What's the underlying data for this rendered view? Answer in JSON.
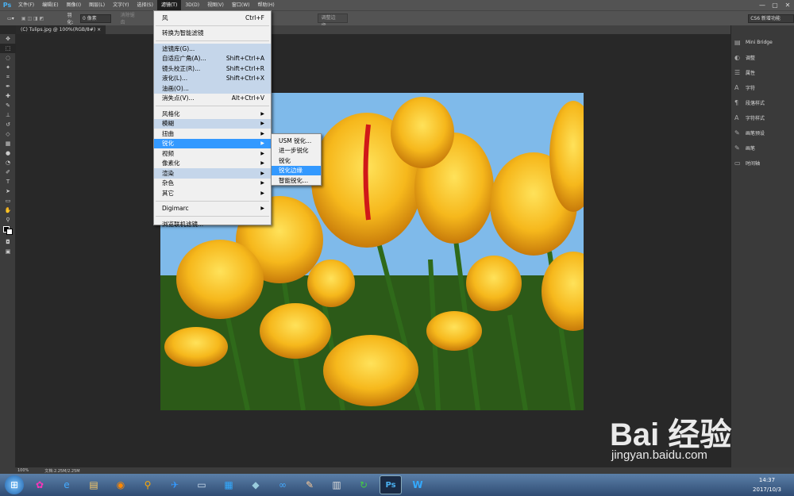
{
  "app": {
    "logo": "Ps"
  },
  "menubar": [
    "文件(F)",
    "编辑(E)",
    "图像(I)",
    "图层(L)",
    "文字(Y)",
    "选择(S)",
    "滤镜(T)",
    "3D(D)",
    "视图(V)",
    "窗口(W)",
    "帮助(H)"
  ],
  "window_controls": [
    "—",
    "▢",
    "✕"
  ],
  "options": {
    "feather_label": "羽化:",
    "feather_value": "0 像素",
    "anti_alias": "消除锯齿",
    "refine_edge": "调整边缘...",
    "workspace": "CS6 新增功能"
  },
  "document_tab": "(C) Tulips.jpg @ 100%(RGB/8#)",
  "filter_menu": {
    "items": [
      {
        "label": "风",
        "shortcut": "Ctrl+F"
      },
      {
        "sep": true
      },
      {
        "label": "转换为智能滤镜",
        "shortcut": ""
      },
      {
        "sep": true
      },
      {
        "label": "滤镜库(G)...",
        "shortcut": "",
        "hl": true
      },
      {
        "label": "自适应广角(A)...",
        "shortcut": "Shift+Ctrl+A",
        "hl": true
      },
      {
        "label": "镜头校正(R)...",
        "shortcut": "Shift+Ctrl+R",
        "hl": true
      },
      {
        "label": "液化(L)...",
        "shortcut": "Shift+Ctrl+X",
        "hl": true
      },
      {
        "label": "油画(O)...",
        "shortcut": "",
        "hl": true
      },
      {
        "label": "消失点(V)...",
        "shortcut": "Alt+Ctrl+V"
      },
      {
        "sep": true
      },
      {
        "label": "风格化",
        "sub": true
      },
      {
        "label": "模糊",
        "sub": true,
        "hl": true
      },
      {
        "label": "扭曲",
        "sub": true
      },
      {
        "label": "锐化",
        "sub": true,
        "sel": true
      },
      {
        "label": "视频",
        "sub": true
      },
      {
        "label": "像素化",
        "sub": true
      },
      {
        "label": "渲染",
        "sub": true,
        "hl": true
      },
      {
        "label": "杂色",
        "sub": true
      },
      {
        "label": "其它",
        "sub": true
      },
      {
        "sep": true
      },
      {
        "label": "Digimarc",
        "sub": true
      },
      {
        "sep": true
      },
      {
        "label": "浏览联机滤镜...",
        "shortcut": ""
      }
    ]
  },
  "sharpen_submenu": [
    "USM 锐化...",
    "进一步锐化",
    "锐化",
    "锐化边缘",
    "智能锐化..."
  ],
  "sharpen_selected": "锐化边缘",
  "panels": [
    {
      "icon": "mini-bridge-icon",
      "glyph": "▤",
      "label": "Mini Bridge"
    },
    {
      "icon": "adjustments-icon",
      "glyph": "◐",
      "label": "调整"
    },
    {
      "icon": "properties-icon",
      "glyph": "☰",
      "label": "属性"
    },
    {
      "icon": "character-icon",
      "glyph": "A",
      "label": "字符"
    },
    {
      "icon": "paragraph-style-icon",
      "glyph": "¶",
      "label": "段落样式"
    },
    {
      "icon": "character-style-icon",
      "glyph": "A",
      "label": "字符样式"
    },
    {
      "icon": "brush-presets-icon",
      "glyph": "✎",
      "label": "画笔预设"
    },
    {
      "icon": "brush-icon",
      "glyph": "✎",
      "label": "画笔"
    },
    {
      "icon": "timeline-icon",
      "glyph": "▭",
      "label": "时间轴"
    }
  ],
  "status": {
    "zoom": "100%",
    "doc": "文档:2.25M/2.25M"
  },
  "watermark": {
    "brand": "Bai 经验",
    "url": "jingyan.baidu.com"
  },
  "clock": {
    "time": "14:37",
    "date": "2017/10/3"
  }
}
